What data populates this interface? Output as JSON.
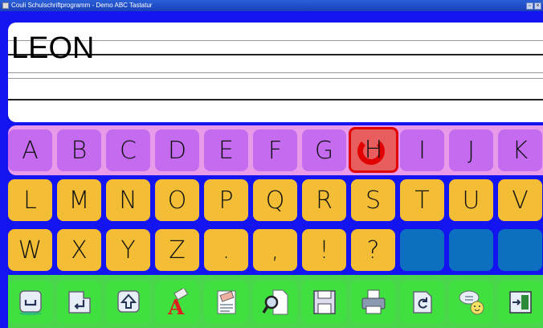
{
  "window": {
    "title": "Couli Schulschriftprogramm - Demo ABC Tastatur"
  },
  "writing_area": {
    "text": "LEON"
  },
  "keyboard": {
    "rows": [
      {
        "keys": [
          "A",
          "B",
          "C",
          "D",
          "E",
          "F",
          "G",
          "H",
          "I",
          "J",
          "K"
        ],
        "active": "H"
      },
      {
        "keys": [
          "L",
          "M",
          "N",
          "O",
          "P",
          "Q",
          "R",
          "S",
          "T",
          "U",
          "V"
        ]
      },
      {
        "keys": [
          "W",
          "X",
          "Y",
          "Z",
          ".",
          ",",
          "!",
          "?",
          "",
          "",
          ""
        ]
      }
    ],
    "function_keys": [
      "space-icon",
      "enter-icon",
      "shift-icon",
      "erase-letter-icon",
      "clear-text-icon",
      "search-document-icon",
      "save-icon",
      "print-icon",
      "undo-icon",
      "speak-icon",
      "exit-icon"
    ]
  },
  "colors": {
    "background": "#1414f0",
    "letter_row_1": "#c46bf0",
    "letter_rows": "#f3be35",
    "empty_key": "#0c6fc0",
    "function_row": "#3fe03f",
    "active_key": "#e85d5d"
  }
}
